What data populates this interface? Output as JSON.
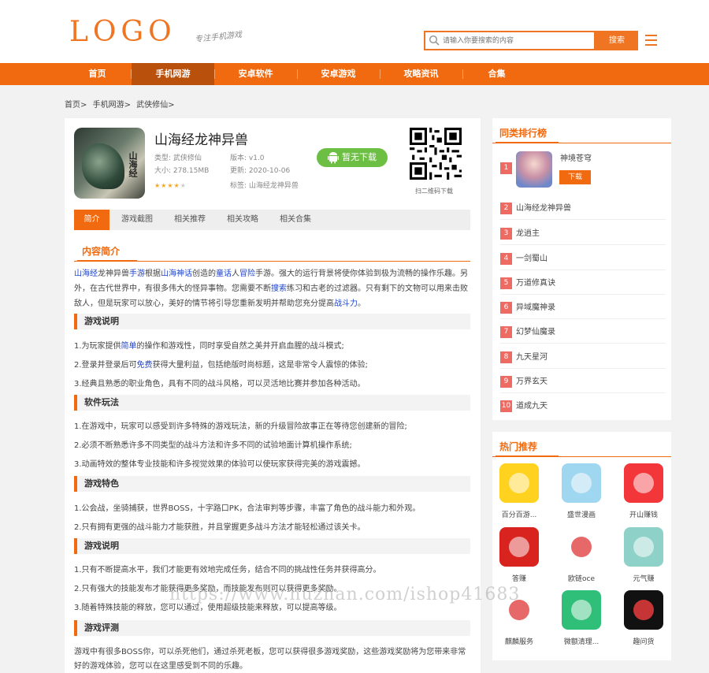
{
  "header": {
    "logo": "LOGO",
    "slogan": "专注手机游戏",
    "search_placeholder": "请输入你要搜索的内容",
    "search_button": "搜索"
  },
  "nav": [
    "首页",
    "手机网游",
    "安卓软件",
    "安卓游戏",
    "攻略资讯",
    "合集"
  ],
  "breadcrumb": [
    "首页>",
    "手机网游>",
    "武侠修仙>"
  ],
  "app": {
    "title": "山海经龙神异兽",
    "type": "类型: 武侠修仙",
    "version": "版本: v1.0",
    "size": "大小: 278.15MB",
    "updated": "更新: 2020-10-06",
    "tags": "标签: 山海经龙神异兽",
    "rating_stars": 4,
    "rating_max": 5,
    "download_label": "暂无下载",
    "qr_caption": "扫二维码下载",
    "icon_text": "山海经"
  },
  "tabs": [
    "简介",
    "游戏截图",
    "相关推荐",
    "相关攻略",
    "相关合集"
  ],
  "content": {
    "section_title": "内容简介",
    "intro": {
      "t1": "山海经",
      "t2": "龙神异兽",
      "t3": "手游",
      "t4": "根据",
      "t5": "山海神话",
      "t6": "创造的",
      "t7": "童话",
      "t8": "人",
      "t9": "冒险",
      "t10": "手游。强大的运行背景将使你体验到极为流畅的操作乐趣。另外，在古代世界中，有很多伟大的怪异事物。您需要不断",
      "t11": "搜索",
      "t12": "练习和古老的过滤器。只有剩下的文物可以用来击败敌人，但是玩家可以放心，美好的情节将引导您重新发明并帮助您充分提高",
      "t13": "战斗力",
      "t14": "。"
    },
    "s1": {
      "title": "游戏说明",
      "p1a": "1.为玩家提供",
      "p1link": "简单",
      "p1b": "的操作和游戏性，同时享受自然之美并开启血腥的战斗模式;",
      "p2a": "2.登录并登录后可",
      "p2link": "免费",
      "p2b": "获得大量利益，包括绝版时尚标题，这是非常令人震惊的体验;",
      "p3": "3.经典且熟悉的职业角色，具有不同的战斗风格，可以灵活地比赛并参加各种活动。"
    },
    "s2": {
      "title": "软件玩法",
      "p1": "1.在游戏中，玩家可以感受到许多特殊的游戏玩法，新的升级冒险故事正在等待您创建新的冒险;",
      "p2": "2.必须不断熟悉许多不同类型的战斗方法和许多不同的试验地面计算机操作系统;",
      "p3": "3.动画特效的整体专业技能和许多视觉效果的体验可以使玩家获得完美的游戏震撼。"
    },
    "s3": {
      "title": "游戏特色",
      "p1": "1.公会战，坐骑捕获，世界BOSS，十字路口PK，合法审判等步骤，丰富了角色的战斗能力和外观。",
      "p2": "2.只有拥有更强的战斗能力才能获胜，并且掌握更多战斗方法才能轻松通过该关卡。"
    },
    "s4": {
      "title": "游戏说明",
      "p1": "1.只有不断提高水平，我们才能更有效地完成任务，结合不同的挑战性任务并获得高分。",
      "p2": "2.只有强大的技能发布才能获得更多奖励，而技能发布则可以获得更多奖励。",
      "p3": "3.随着特殊技能的释放，您可以通过，使用超级技能来释放，可以提高等级。"
    },
    "s5": {
      "title": "游戏评测",
      "p1": "游戏中有很多BOSS你，可以杀死他们，通过杀死老板，您可以获得很多游戏奖励，这些游戏奖励将为您带来非常好的游戏体验，您可以在这里感受到不同的乐趣。"
    }
  },
  "watermark": "https://www.huzhan.com/ishop41683",
  "ranking": {
    "title": "同类排行榜",
    "top": {
      "num": "1",
      "name": "神境苍穹",
      "download": "下载"
    },
    "rows": [
      {
        "num": "2",
        "name": "山海经龙神异兽"
      },
      {
        "num": "3",
        "name": "龙逍主"
      },
      {
        "num": "4",
        "name": "一剑蜀山"
      },
      {
        "num": "5",
        "name": "万道修真诀"
      },
      {
        "num": "6",
        "name": "异域魔神录"
      },
      {
        "num": "7",
        "name": "幻梦仙魔录"
      },
      {
        "num": "8",
        "name": "九天星河"
      },
      {
        "num": "9",
        "name": "万界玄天"
      },
      {
        "num": "10",
        "name": "道成九天"
      }
    ]
  },
  "hot": {
    "title": "热门推荐",
    "items": [
      {
        "name": "百分百游...",
        "icon": "smiley-icon",
        "color": "#ffd21f"
      },
      {
        "name": "盛世漫画",
        "icon": "anime-icon",
        "color": "#9fd6f0"
      },
      {
        "name": "开山赚钱",
        "icon": "coin-icon",
        "color": "#f2363a"
      },
      {
        "name": "答赚",
        "icon": "earn-icon",
        "color": "#d8231f"
      },
      {
        "name": "欧链oce",
        "icon": "oce-icon",
        "color": "#ffffff"
      },
      {
        "name": "元气赚",
        "icon": "shoes-icon",
        "color": "#8ed1c8"
      },
      {
        "name": "麒麟服务",
        "icon": "leaf-icon",
        "color": "#ffffff"
      },
      {
        "name": "微额清理...",
        "icon": "fan-icon",
        "color": "#2fbf79"
      },
      {
        "name": "趣问货",
        "icon": "rocket-icon",
        "color": "#111111"
      }
    ]
  }
}
